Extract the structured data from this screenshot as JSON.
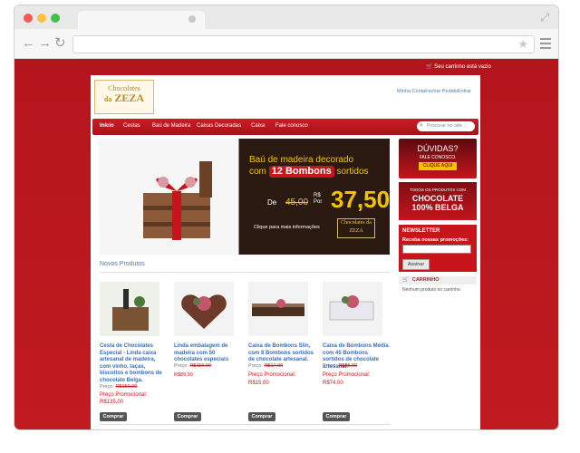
{
  "browser": {
    "window_buttons": [
      "close",
      "minimize",
      "maximize"
    ],
    "colors": {
      "close": "#f25c54",
      "minimize": "#f7c23d",
      "maximize": "#3fc14a"
    }
  },
  "site": {
    "top_cart_text": "Seu carrinho está vazio",
    "logo_line1": "Chocolates",
    "logo_line2_a": "da",
    "logo_line2_b": "ZEZA",
    "account_links": [
      "Minha Conta",
      "Fechar Pedido",
      "Entrar"
    ],
    "nav": [
      "Início",
      "Cestas",
      "Baú de Madeira",
      "Caixas Decoradas",
      "Caixa",
      "Fale conosco"
    ],
    "search_placeholder": "Procurar no site...",
    "colors": {
      "brand_red": "#c8151c",
      "gold": "#f2c400",
      "link_blue": "#3a6fb5"
    }
  },
  "banner": {
    "title_line1": "Baú de madeira decorado",
    "title_line2_a": "com",
    "title_line2_b": "12 Bombons",
    "title_line2_c": "sortidos",
    "de_label": "De",
    "old_price": "45,00",
    "currency": "R$",
    "por_label": "Por",
    "new_price": "37,50",
    "info_text": "Clique para mais informações",
    "logo_text": "Chocolates da ZEZA"
  },
  "sidebar": {
    "ad1_title": "DÚVIDAS?",
    "ad1_sub": "FALE CONOSCO.",
    "ad1_button": "CLIQUE AQUI",
    "ad2_line1": "TODOS OS PRODUTOS COM",
    "ad2_line2": "CHOCOLATE",
    "ad2_line3": "100% BELGA",
    "newsletter_title": "NEWSLETTER",
    "newsletter_label": "Receba nossas promoções:",
    "newsletter_button": "Assinar",
    "cart_title": "CARRINHO",
    "cart_text": "Nenhum produto no carrinho."
  },
  "products_section": {
    "title": "Novos Produtos",
    "price_label": "Preço:",
    "promo_label": "Preço Promocional:",
    "buy_label": "Comprar",
    "items": [
      {
        "name": "Cesta de Chocolates Especial - Linda caixa artesanal de madeira, com vinho, taças, biscoitos e bombons de chocolate Belga.",
        "old_price": "R$150,00",
        "promo_price": "R$135,00"
      },
      {
        "name": "Linda embalagem de madeira com 50 chocolates especiais",
        "old_price": "R$110,00",
        "promo_price": "R$89,90"
      },
      {
        "name": "Caixa de Bombons Slin, com 8 Bombons sortidos de chocolate artesanal.",
        "old_price": "R$17,00",
        "promo_price": "R$15,00"
      },
      {
        "name": "Caixa de Bombons Média com 45 Bombons sortidos de chocolate artesanal.",
        "old_price": "R$85,00",
        "promo_price": "R$74,00"
      }
    ]
  }
}
